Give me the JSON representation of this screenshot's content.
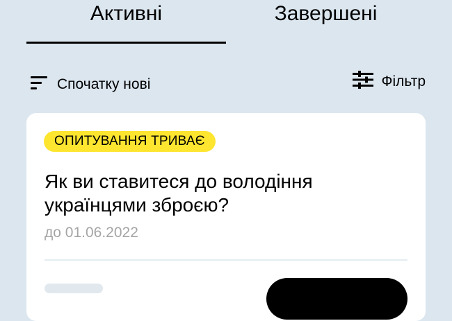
{
  "tabs": {
    "active_label": "Активні",
    "done_label": "Завершені"
  },
  "sort": {
    "label": "Спочатку нові",
    "icon": "sort-lines-icon"
  },
  "filter": {
    "label": "Фільтр",
    "icon": "sliders-icon"
  },
  "poll": {
    "status": "ОПИТУВАННЯ ТРИВАЄ",
    "question": "Як ви ставитеся до володіння українцями зброєю?",
    "deadline": "до 01.06.2022"
  },
  "colors": {
    "background": "#dbe6ef",
    "badge": "#fde530",
    "card": "#ffffff",
    "muted_text": "#a5a5a5"
  }
}
